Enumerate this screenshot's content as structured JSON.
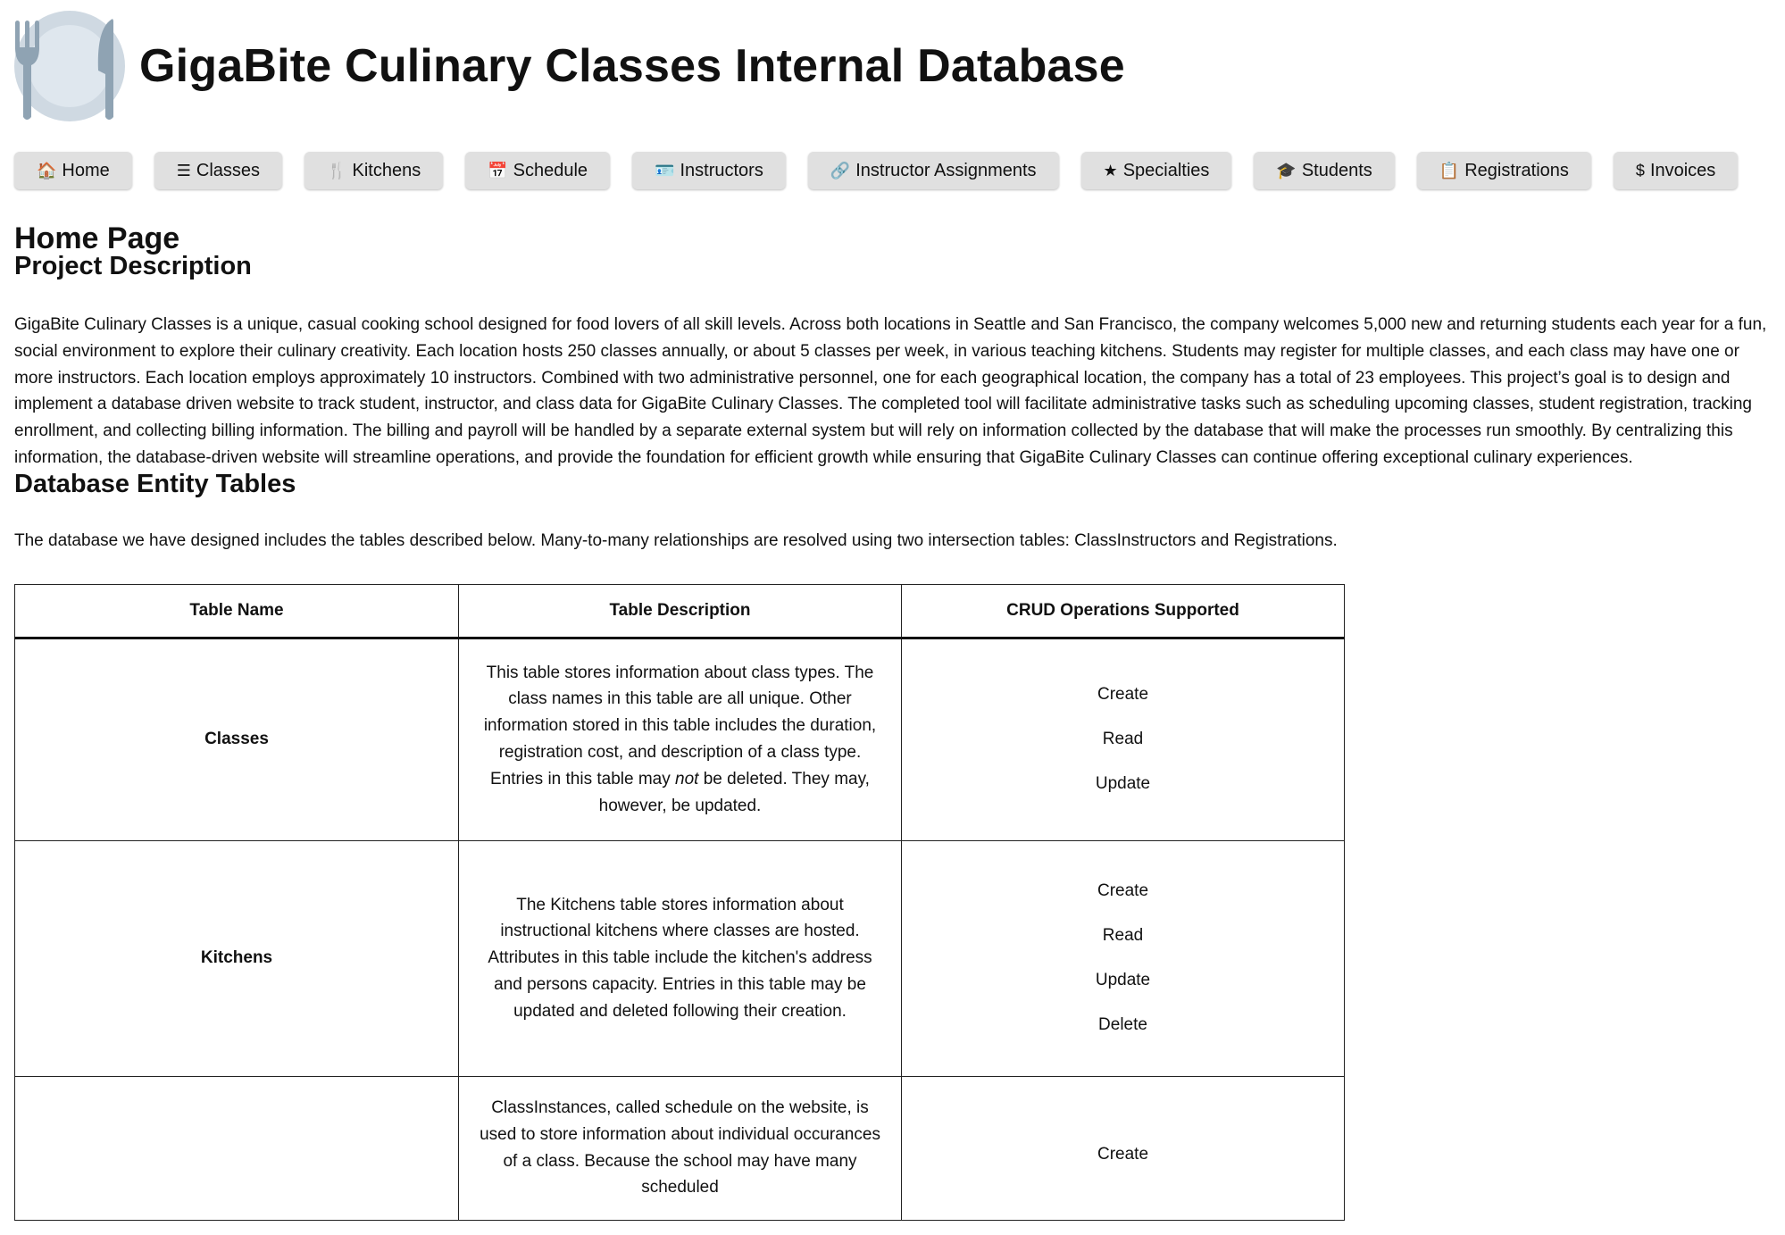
{
  "header": {
    "title": "GigaBite Culinary Classes Internal Database",
    "logo_icon": "plate-fork-knife-icon"
  },
  "nav": [
    {
      "icon": "🏠",
      "icon_name": "home-icon",
      "label": "Home"
    },
    {
      "icon": "☰",
      "icon_name": "list-icon",
      "label": "Classes"
    },
    {
      "icon": "🍴",
      "icon_name": "fork-knife-icon",
      "label": "Kitchens"
    },
    {
      "icon": "📅",
      "icon_name": "calendar-icon",
      "label": "Schedule"
    },
    {
      "icon": "🪪",
      "icon_name": "id-card-icon",
      "label": "Instructors"
    },
    {
      "icon": "🔗",
      "icon_name": "link-icon",
      "label": "Instructor Assignments"
    },
    {
      "icon": "★",
      "icon_name": "star-icon",
      "label": "Specialties"
    },
    {
      "icon": "🎓",
      "icon_name": "graduation-cap-icon",
      "label": "Students"
    },
    {
      "icon": "📋",
      "icon_name": "clipboard-icon",
      "label": "Registrations"
    },
    {
      "icon": "$",
      "icon_name": "dollar-icon",
      "label": "Invoices"
    }
  ],
  "page": {
    "title": "Home Page"
  },
  "project": {
    "heading": "Project Description",
    "text": "GigaBite Culinary Classes is a unique, casual cooking school designed for food lovers of all skill levels. Across both locations in Seattle and San Francisco, the company welcomes 5,000 new and returning students each year for a fun, social environment to explore their culinary creativity. Each location hosts 250 classes annually, or about 5 classes per week, in various teaching kitchens. Students may register for multiple classes, and each class may have one or more instructors. Each location employs approximately 10 instructors. Combined with two administrative personnel, one for each geographical location, the company has a total of 23 employees. This project’s goal is to design and implement a database driven website to track student, instructor, and class data for GigaBite Culinary Classes. The completed tool will facilitate administrative tasks such as scheduling upcoming classes, student registration, tracking enrollment, and collecting billing information. The billing and payroll will be handled by a separate external system but will rely on information collected by the database that will make the processes run smoothly. By centralizing this information, the database-driven website will streamline operations, and provide the foundation for efficient growth while ensuring that GigaBite Culinary Classes can continue offering exceptional culinary experiences."
  },
  "entities": {
    "heading": "Database Entity Tables",
    "intro": "The database we have designed includes the tables described below. Many-to-many relationships are resolved using two intersection tables: ClassInstructors and Registrations.",
    "columns": [
      "Table Name",
      "Table Description",
      "CRUD Operations Supported"
    ],
    "rows": [
      {
        "name": "Classes",
        "desc_before": "This table stores information about class types. The class names in this table are all unique. Other information stored in this table includes the duration, registration cost, and description of a class type. Entries in this table may ",
        "desc_em": "not",
        "desc_after": " be deleted. They may, however, be updated.",
        "crud": [
          "Create",
          "Read",
          "Update"
        ]
      },
      {
        "name": "Kitchens",
        "desc": "The Kitchens table stores information about instructional kitchens where classes are hosted. Attributes in this table include the kitchen's address and persons capacity. Entries in this table may be updated and deleted following their creation.",
        "crud": [
          "Create",
          "Read",
          "Update",
          "Delete"
        ]
      },
      {
        "name": "",
        "desc": "ClassInstances, called schedule on the website, is used to store information about individual occurances of a class. Because the school may have many scheduled",
        "crud": [
          "Create"
        ]
      }
    ]
  }
}
